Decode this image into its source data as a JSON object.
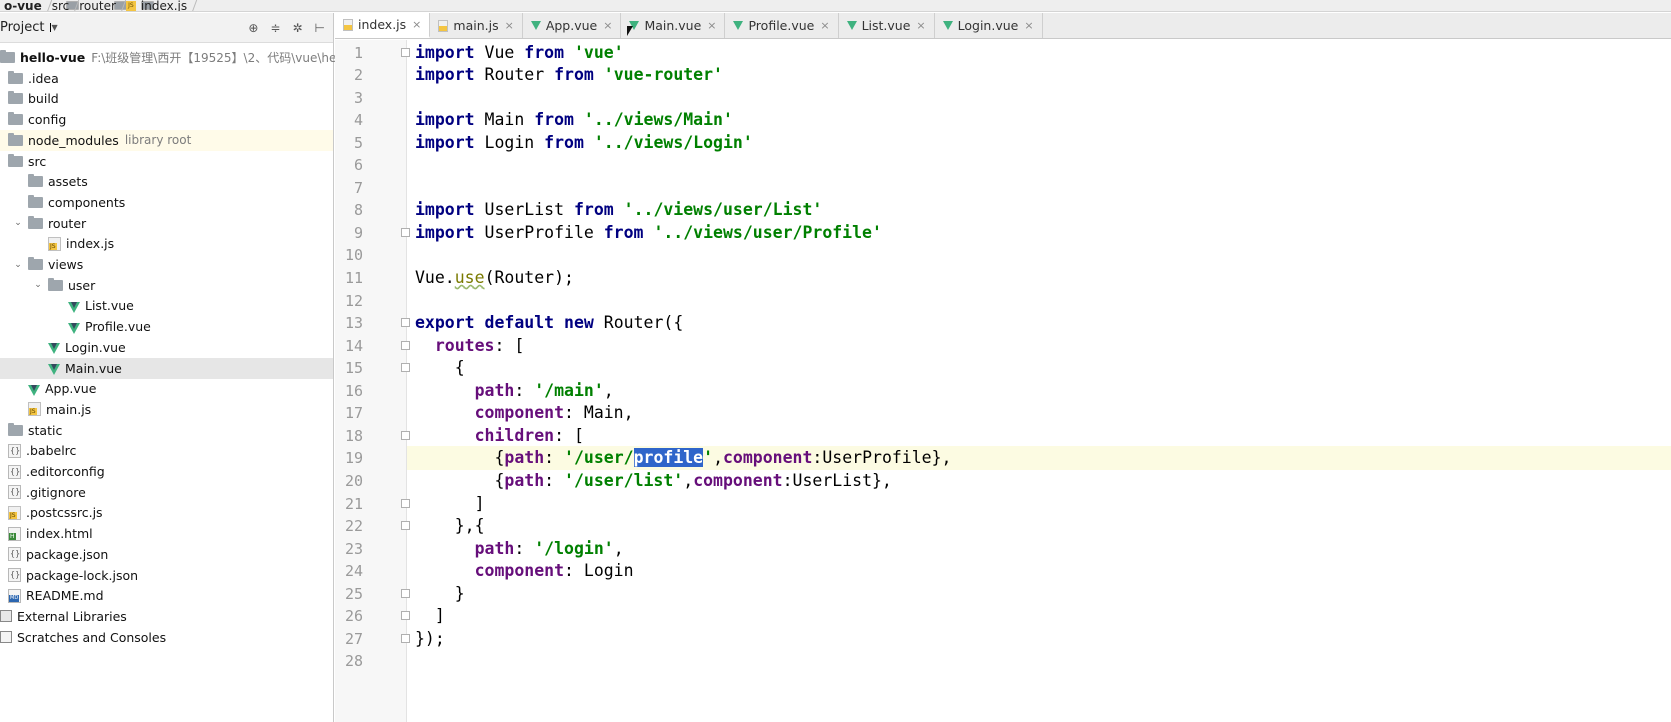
{
  "breadcrumb": [
    {
      "label": "o-vue",
      "icon": "folder-icon",
      "bold": true
    },
    {
      "label": "src",
      "icon": "folder-icon"
    },
    {
      "label": "router",
      "icon": "folder-icon"
    },
    {
      "label": "index.js",
      "icon": "js-file-icon"
    }
  ],
  "project_panel": {
    "title": "Project",
    "tree": [
      {
        "label": "hello-vue",
        "hint": "F:\\班级管理\\西开【19525】\\2、代码\\vue\\hello-v",
        "icon": "module-icon",
        "bold": true
      },
      {
        "label": ".idea",
        "icon": "folder-icon"
      },
      {
        "label": "build",
        "icon": "folder-icon"
      },
      {
        "label": "config",
        "icon": "folder-icon"
      },
      {
        "label": "node_modules",
        "hint": "library root",
        "icon": "folder-icon"
      },
      {
        "label": "src",
        "icon": "folder-icon"
      },
      {
        "label": "assets",
        "icon": "folder-icon"
      },
      {
        "label": "components",
        "icon": "folder-icon"
      },
      {
        "label": "router",
        "icon": "folder-icon"
      },
      {
        "label": "index.js",
        "icon": "js-file-icon"
      },
      {
        "label": "views",
        "icon": "folder-icon"
      },
      {
        "label": "user",
        "icon": "folder-icon"
      },
      {
        "label": "List.vue",
        "icon": "vue-file-icon"
      },
      {
        "label": "Profile.vue",
        "icon": "vue-file-icon"
      },
      {
        "label": "Login.vue",
        "icon": "vue-file-icon"
      },
      {
        "label": "Main.vue",
        "icon": "vue-file-icon",
        "selected": true
      },
      {
        "label": "App.vue",
        "icon": "vue-file-icon"
      },
      {
        "label": "main.js",
        "icon": "js-file-icon"
      },
      {
        "label": "static",
        "icon": "folder-icon"
      },
      {
        "label": ".babelrc",
        "icon": "config-file-icon"
      },
      {
        "label": ".editorconfig",
        "icon": "config-file-icon"
      },
      {
        "label": ".gitignore",
        "icon": "config-file-icon"
      },
      {
        "label": ".postcssrc.js",
        "icon": "js-file-icon"
      },
      {
        "label": "index.html",
        "icon": "html-file-icon"
      },
      {
        "label": "package.json",
        "icon": "config-file-icon"
      },
      {
        "label": "package-lock.json",
        "icon": "config-file-icon"
      },
      {
        "label": "README.md",
        "icon": "markdown-file-icon"
      },
      {
        "label": "External Libraries",
        "icon": "library-icon"
      },
      {
        "label": "Scratches and Consoles",
        "icon": "scratch-icon"
      }
    ]
  },
  "tabs": [
    {
      "label": "index.js",
      "icon": "js-file-icon",
      "active": true
    },
    {
      "label": "main.js",
      "icon": "js-file-icon"
    },
    {
      "label": "App.vue",
      "icon": "vue-file-icon"
    },
    {
      "label": "Main.vue",
      "icon": "vue-file-icon"
    },
    {
      "label": "Profile.vue",
      "icon": "vue-file-icon"
    },
    {
      "label": "List.vue",
      "icon": "vue-file-icon"
    },
    {
      "label": "Login.vue",
      "icon": "vue-file-icon"
    }
  ],
  "editor": {
    "current_line": 19,
    "selected_text": "profile",
    "lines": [
      "import Vue from 'vue'",
      "import Router from 'vue-router'",
      "",
      "import Main from '../views/Main'",
      "import Login from '../views/Login'",
      "",
      "",
      "import UserList from '../views/user/List'",
      "import UserProfile from '../views/user/Profile'",
      "",
      "Vue.use(Router);",
      "",
      "export default new Router({",
      "  routes: [",
      "    {",
      "      path: '/main',",
      "      component: Main,",
      "      children: [",
      "        {path: '/user/profile',component:UserProfile},",
      "        {path: '/user/list',component:UserList},",
      "      ]",
      "    },{",
      "      path: '/login',",
      "      component: Login",
      "    }",
      "  ]",
      "});",
      ""
    ]
  },
  "colors": {
    "keyword": "#000080",
    "string": "#008000",
    "property": "#660e7a",
    "selection": "#2f65ca",
    "current_line_bg": "#fcfbe2"
  }
}
